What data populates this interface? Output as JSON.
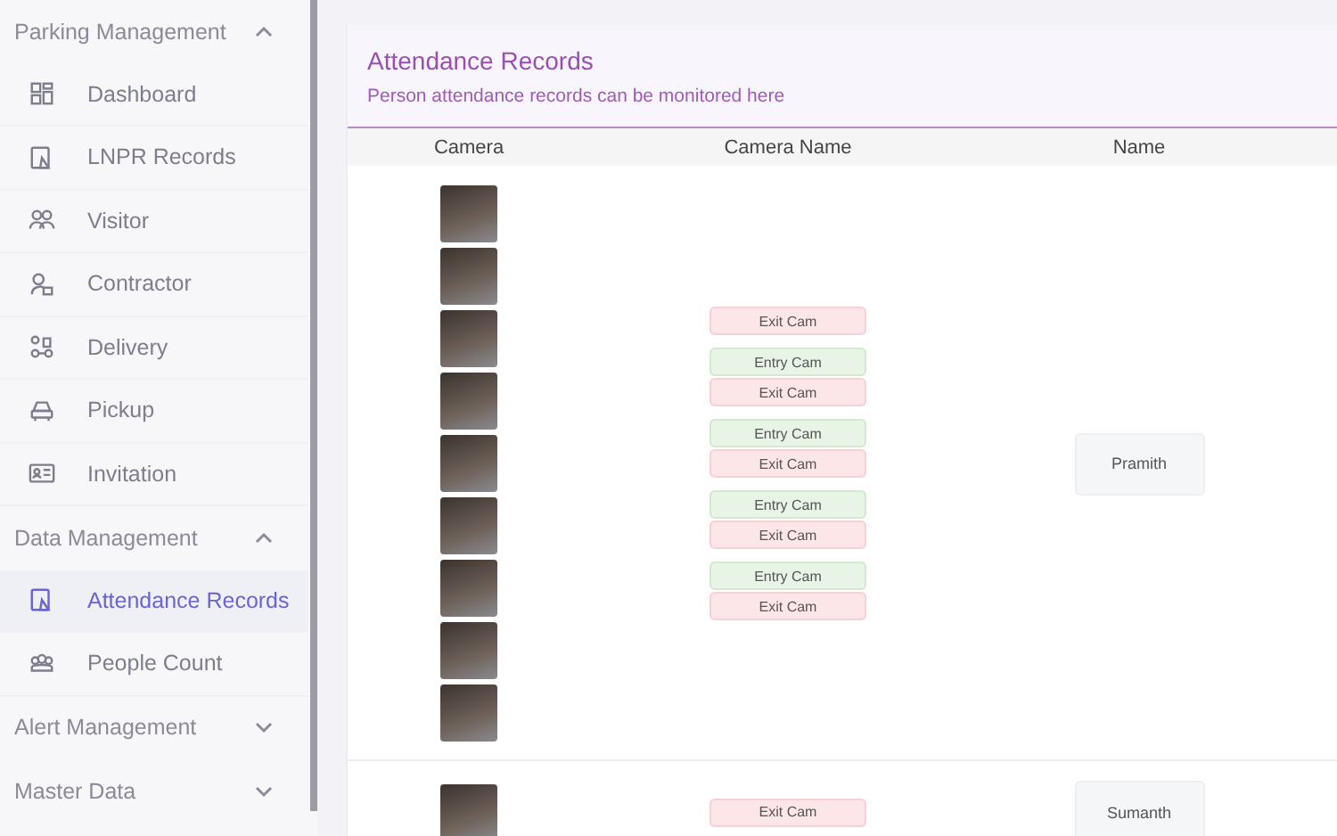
{
  "sidebar": {
    "sections": [
      {
        "title": "Parking Management",
        "expanded": true,
        "items": [
          {
            "label": "Dashboard",
            "selected": false
          },
          {
            "label": "LNPR Records",
            "selected": false
          },
          {
            "label": "Visitor",
            "selected": false
          },
          {
            "label": "Contractor",
            "selected": false
          },
          {
            "label": "Delivery",
            "selected": false
          },
          {
            "label": "Pickup",
            "selected": false
          },
          {
            "label": "Invitation",
            "selected": false
          }
        ]
      },
      {
        "title": "Data Management",
        "expanded": true,
        "items": [
          {
            "label": "Attendance Records",
            "selected": true
          },
          {
            "label": "People Count",
            "selected": false
          }
        ]
      },
      {
        "title": "Alert Management",
        "expanded": false
      },
      {
        "title": "Master Data",
        "expanded": false
      }
    ]
  },
  "card": {
    "title": "Attendance Records",
    "subtitle": "Person attendance records can be monitored here"
  },
  "table": {
    "columns": [
      "Camera",
      "Camera Name",
      "Name"
    ],
    "rows": [
      {
        "photos": [
          {
            "kind": "photo"
          },
          {
            "kind": "photo"
          },
          {
            "kind": "photo"
          },
          {
            "kind": "photo"
          },
          {
            "kind": "photo"
          },
          {
            "kind": "photo"
          },
          {
            "kind": "photo"
          },
          {
            "kind": "photo"
          },
          {
            "kind": "photo"
          }
        ],
        "camera_names": [
          [
            {
              "label": "Exit Cam",
              "kind": "exit"
            }
          ],
          [
            {
              "label": "Entry Cam",
              "kind": "entry"
            },
            {
              "label": "Exit Cam",
              "kind": "exit"
            }
          ],
          [
            {
              "label": "Entry Cam",
              "kind": "entry"
            },
            {
              "label": "Exit Cam",
              "kind": "exit"
            }
          ],
          [
            {
              "label": "Entry Cam",
              "kind": "entry"
            },
            {
              "label": "Exit Cam",
              "kind": "exit"
            }
          ],
          [
            {
              "label": "Entry Cam",
              "kind": "entry"
            },
            {
              "label": "Exit Cam",
              "kind": "exit"
            }
          ]
        ],
        "name": "Pramith"
      },
      {
        "photos": [
          {
            "kind": "photo"
          }
        ],
        "camera_names": [
          [
            {
              "label": "Exit Cam",
              "kind": "exit"
            }
          ]
        ],
        "name": "Sumanth"
      }
    ]
  }
}
